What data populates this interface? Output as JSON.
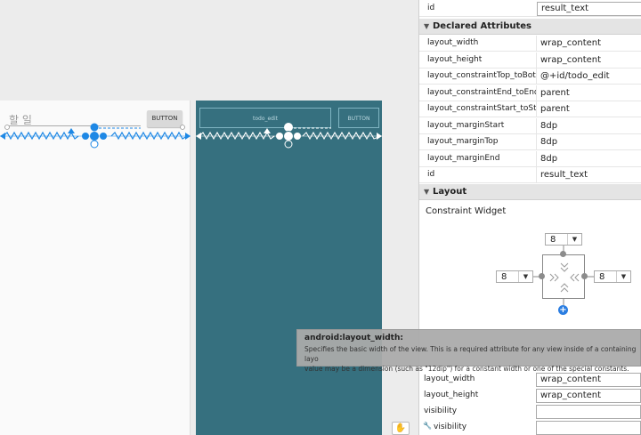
{
  "canvas": {
    "design": {
      "edit_hint": "할 일",
      "button_label": "BUTTON"
    },
    "blueprint": {
      "edit_label": "todo_edit",
      "button_label": "BUTTON"
    },
    "hand_icon": "pan-hand-icon"
  },
  "top_attribute": {
    "key": "id",
    "value": "result_text"
  },
  "declared": {
    "title": "Declared Attributes",
    "rows": [
      {
        "key": "layout_width",
        "value": "wrap_content"
      },
      {
        "key": "layout_height",
        "value": "wrap_content"
      },
      {
        "key": "layout_constraintTop_toBott...",
        "value": "@+id/todo_edit"
      },
      {
        "key": "layout_constraintEnd_toEndOf",
        "value": "parent"
      },
      {
        "key": "layout_constraintStart_toSta...",
        "value": "parent"
      },
      {
        "key": "layout_marginStart",
        "value": "8dp"
      },
      {
        "key": "layout_marginTop",
        "value": "8dp"
      },
      {
        "key": "layout_marginEnd",
        "value": "8dp"
      },
      {
        "key": "id",
        "value": "result_text"
      }
    ]
  },
  "layout": {
    "title": "Layout",
    "subtitle": "Constraint Widget",
    "margins": {
      "top": "8",
      "left": "8",
      "right": "8"
    }
  },
  "tooltip": {
    "title": "android:layout_width:",
    "line1": "Specifies the basic width of the view. This is a required attribute for any view inside of a containing layo",
    "line2": "value may be a dimension (such as \"12dip\") for a constant width or one of the special constants."
  },
  "bottom_rows": [
    {
      "key": "layout_width",
      "value": "wrap_content"
    },
    {
      "key": "layout_height",
      "value": "wrap_content"
    },
    {
      "key": "visibility",
      "value": ""
    },
    {
      "key": "visibility",
      "value": ""
    }
  ],
  "colors": {
    "accent": "#1e88e5",
    "blueprint": "#36707f",
    "tooltip": "#aaaaaa"
  }
}
